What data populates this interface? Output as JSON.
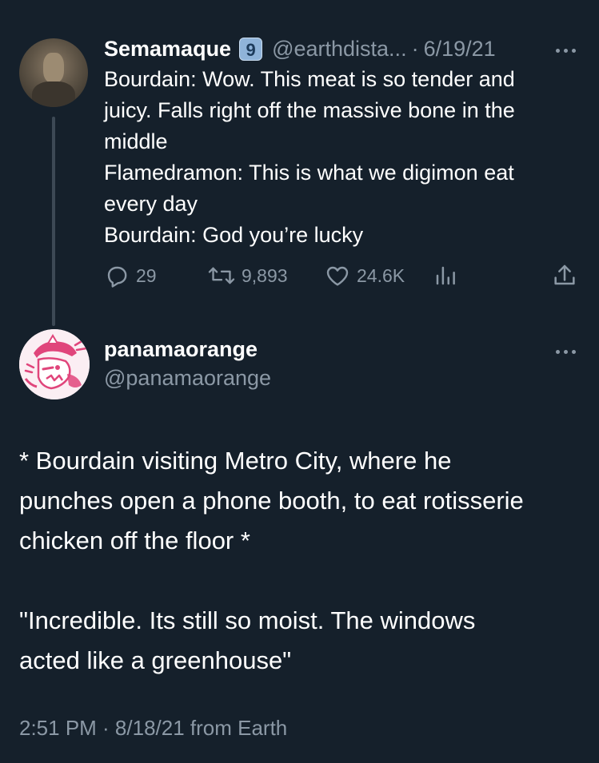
{
  "parent_tweet": {
    "display_name": "Semamaque",
    "badge": "9",
    "handle": "@earthdista...",
    "separator": "·",
    "date": "6/19/21",
    "lines": [
      "Bourdain: Wow. This meat is so tender and",
      "juicy. Falls right off the massive bone in the",
      "middle",
      "Flamedramon: This is what we digimon eat",
      "every day",
      "Bourdain: God you’re lucky"
    ],
    "reply_count": "29",
    "retweet_count": "9,893",
    "like_count": "24.6K",
    "icons": [
      "reply-icon",
      "retweet-icon",
      "like-icon",
      "analytics-icon",
      "share-icon",
      "more-icon"
    ]
  },
  "main_tweet": {
    "display_name": "panamaorange",
    "handle": "@panamaorange",
    "paragraph1": [
      "* Bourdain visiting Metro City, where he",
      "punches open a phone booth, to eat rotisserie",
      "chicken off the floor *"
    ],
    "paragraph2": [
      "\"Incredible. Its still so moist. The windows",
      "acted like a greenhouse\""
    ],
    "timestamp": "2:51 PM · 8/18/21 from Earth"
  },
  "colors": {
    "background": "#15202b",
    "text_primary": "#ffffff",
    "text_secondary": "#8b98a5",
    "thread_line": "#3d4955",
    "avatar2_accent": "#e0457b"
  }
}
